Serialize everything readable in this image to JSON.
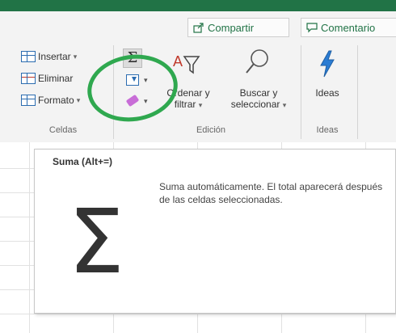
{
  "header": {
    "share_label": "Compartir",
    "comment_label": "Comentario"
  },
  "cells_group": {
    "insert_label": "Insertar",
    "delete_label": "Eliminar",
    "format_label": "Formato",
    "group_label": "Celdas"
  },
  "edit_group": {
    "sort_filter_label_line1": "Ordenar y",
    "sort_filter_label_line2": "filtrar",
    "find_select_label_line1": "Buscar y",
    "find_select_label_line2": "seleccionar",
    "group_label": "Edición",
    "sigma_symbol": "Σ"
  },
  "ideas_group": {
    "ideas_label": "Ideas",
    "group_label": "Ideas"
  },
  "tooltip": {
    "title": "Suma (Alt+=)",
    "description": "Suma automáticamente. El total aparecerá después de las celdas seleccionadas.",
    "sigma_symbol": "Σ"
  },
  "colors": {
    "excel_green": "#217346",
    "highlight_circle": "#2fa84f",
    "ideas_blue": "#2b7cd3"
  },
  "icons": {
    "share": "share-icon",
    "comment": "comment-icon",
    "insert": "insert-cells-icon",
    "delete": "delete-cells-icon",
    "format": "format-cells-icon",
    "autosum": "sigma-icon",
    "fill": "fill-down-icon",
    "clear": "eraser-icon",
    "sort": "sort-filter-icon",
    "find": "magnifier-icon",
    "ideas": "lightning-icon"
  }
}
